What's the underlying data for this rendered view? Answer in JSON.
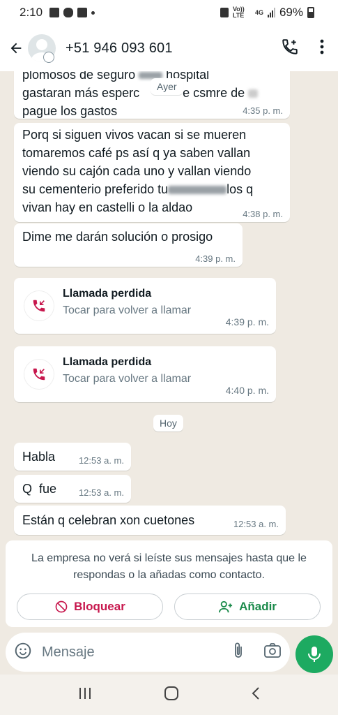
{
  "status_bar": {
    "time": "2:10",
    "network_label": "Vo)) LTE",
    "net_type": "4G",
    "battery": "69%"
  },
  "header": {
    "contact": "+51 946 093 601",
    "icons": [
      "back-arrow-icon",
      "avatar",
      "add-call-icon",
      "more-vert-icon"
    ]
  },
  "messages": [
    {
      "text_line1": "plomosos de seguro",
      "text_line1b": "hospital",
      "text_line2": "gastaran más esperc",
      "text_line2b": "e csmre de",
      "text_line3": "pague los gastos",
      "time": "4:35 p. m."
    },
    {
      "line1": "Porq si siguen vivos vacan si se mueren",
      "line2": "tomaremos café ps así q ya saben vallan",
      "line3": "viendo su cajón cada uno y vallan viendo",
      "line4a": "su cementerio preferido tu",
      "line4b": "los q",
      "line5": "vivan hay en castelli o la aldao",
      "time": "4:38 p. m."
    },
    {
      "text": "Dime me darán solución o prosigo",
      "time": "4:39 p. m."
    },
    {
      "title": "Llamada perdida",
      "sub": "Tocar para volver a llamar",
      "time": "4:39 p. m."
    },
    {
      "title": "Llamada perdida",
      "sub": "Tocar para volver a llamar",
      "time": "4:40 p. m."
    },
    {
      "text": "Habla",
      "time": "12:53 a. m."
    },
    {
      "text": "Q  fue",
      "time": "12:53 a. m."
    },
    {
      "text": "Están q celebran xon cuetones",
      "time": "12:53 a. m."
    }
  ],
  "date_chips": {
    "yesterday": "Ayer",
    "today": "Hoy"
  },
  "notice": {
    "text": "La empresa no verá si leíste sus mensajes hasta que le respondas o la añadas como contacto.",
    "block_label": "Bloquear",
    "add_label": "Añadir"
  },
  "input": {
    "placeholder": "Mensaje"
  },
  "colors": {
    "accent_green": "#1daa61",
    "block_red": "#c7174d",
    "add_green": "#1a8a4a",
    "chat_bg": "#efeae2"
  }
}
